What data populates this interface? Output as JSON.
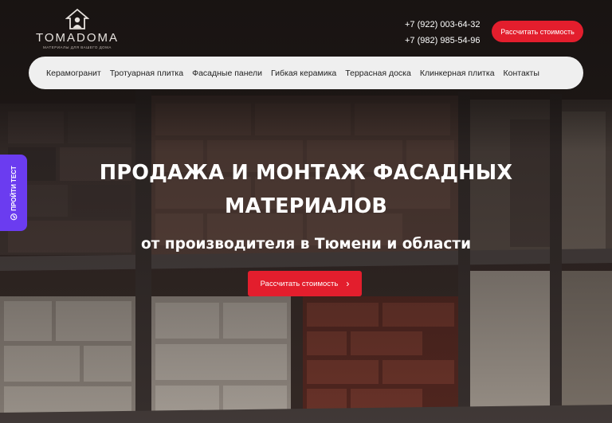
{
  "brand": {
    "name": "TOMADOMA",
    "tagline": "МАТЕРИАЛЫ ДЛЯ ВАШЕГО ДОМА",
    "logo_icon": "house-icon"
  },
  "header": {
    "phones": [
      "+7 (922) 003-64-32",
      "+7 (982) 985-54-96"
    ],
    "cta_label": "Рассчитать стоимость"
  },
  "nav": {
    "items": [
      "Керамогранит",
      "Тротуарная плитка",
      "Фасадные панели",
      "Гибкая керамика",
      "Террасная доска",
      "Клинкерная плитка",
      "Контакты"
    ]
  },
  "hero": {
    "title_line1": "ПРОДАЖА И МОНТАЖ ФАСАДНЫХ",
    "title_line2": "МАТЕРИАЛОВ",
    "subtitle": "от производителя в Тюмени и области",
    "cta_label": "Рассчитать стоимость",
    "cta_icon": "chevron-right-icon"
  },
  "side_tab": {
    "label": "ПРОЙТИ ТЕСТ",
    "icon": "check-circle-icon"
  },
  "colors": {
    "accent": "#e31e2d",
    "side_tab": "#6b3cf0",
    "nav_bg": "#efefef"
  }
}
